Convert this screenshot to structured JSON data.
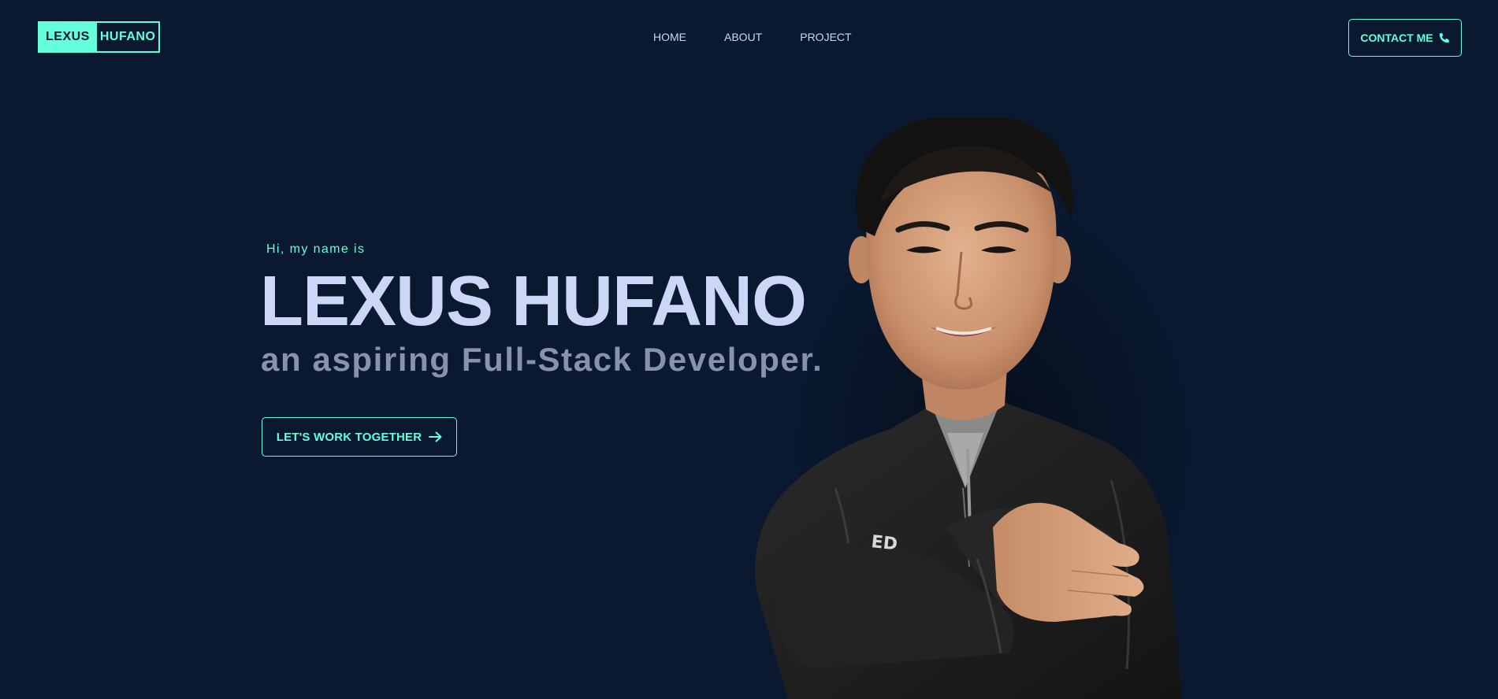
{
  "logo": {
    "first": "LEXUS",
    "last": "HUFANO"
  },
  "nav": {
    "items": [
      {
        "label": "HOME"
      },
      {
        "label": "ABOUT"
      },
      {
        "label": "PROJECT"
      }
    ]
  },
  "contact": {
    "label": "CONTACT ME",
    "icon": "phone-icon"
  },
  "hero": {
    "greeting": "Hi, my name is",
    "name": "LEXUS HUFANO",
    "subtitle": "an aspiring Full-Stack Developer.",
    "cta_label": "LET'S WORK TOGETHER",
    "cta_icon": "arrow-right-icon"
  },
  "colors": {
    "background": "#0a1930",
    "accent": "#64ffda",
    "heading": "#ccd6f6",
    "muted": "#8892b0"
  }
}
